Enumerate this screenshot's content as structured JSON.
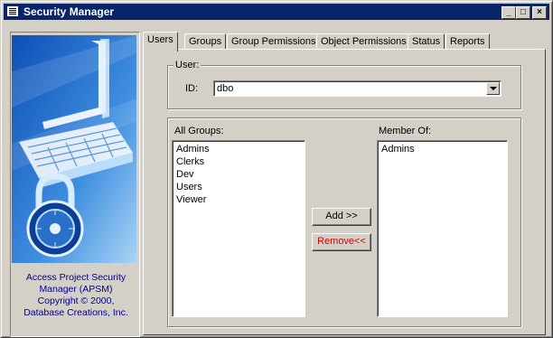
{
  "window": {
    "title": "Security Manager",
    "buttons": {
      "minimize": "_",
      "maximize": "□",
      "close": "×"
    }
  },
  "branding": {
    "credit_lines": [
      "Access Project Security",
      "Manager (APSM)",
      "Copyright © 2000,",
      "Database Creations, Inc."
    ],
    "icon": "laptop-padlock-illustration"
  },
  "tabs": [
    {
      "label": "Users",
      "active": true
    },
    {
      "label": "Groups",
      "active": false
    },
    {
      "label": "Group Permissions",
      "active": false
    },
    {
      "label": "Object Permissions",
      "active": false
    },
    {
      "label": "Status",
      "active": false
    },
    {
      "label": "Reports",
      "active": false
    }
  ],
  "user_group": {
    "legend": "User:",
    "id_label": "ID:",
    "id_value": "dbo"
  },
  "groups": {
    "all_groups_label": "All Groups:",
    "all_groups": [
      "Admins",
      "Clerks",
      "Dev",
      "Users",
      "Viewer"
    ],
    "member_of_label": "Member Of:",
    "member_of": [
      "Admins"
    ],
    "add_label": "Add >>",
    "remove_label": "Remove<<"
  },
  "colors": {
    "titlebar": "#0a246a",
    "credit_text": "#00008b",
    "remove_text": "#e00000"
  }
}
